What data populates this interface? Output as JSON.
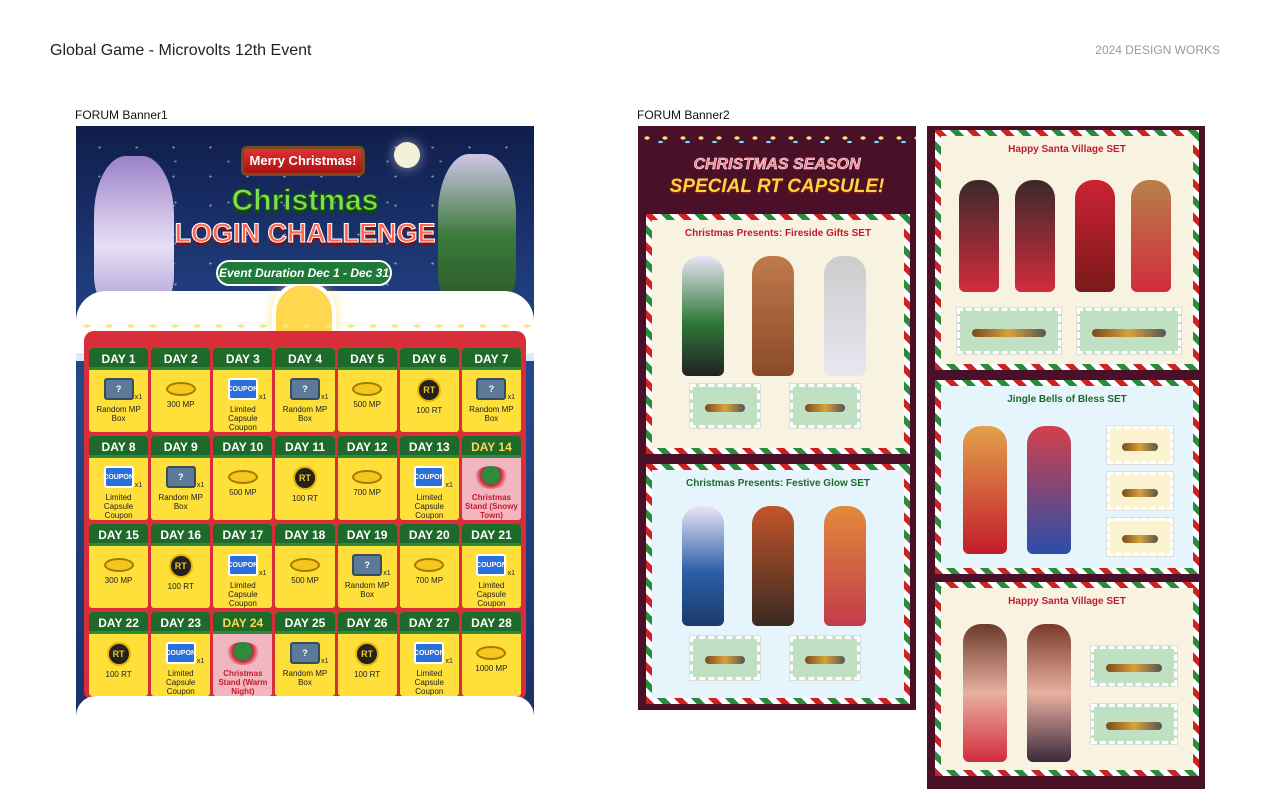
{
  "header": {
    "title": "Global Game - Microvolts 12th Event",
    "right_label": "2024 DESIGN WORKS"
  },
  "banner1": {
    "label": "FORUM Banner1",
    "sign": "Merry Christmas!",
    "title1": "Christmas",
    "title2": "LOGIN CHALLENGE",
    "duration": "Event Duration Dec 1 - Dec 31",
    "days": [
      {
        "day": "DAY 1",
        "type": "box",
        "qty": "x1",
        "name": "Random MP Box"
      },
      {
        "day": "DAY 2",
        "type": "mp",
        "qty": "",
        "name": "300 MP"
      },
      {
        "day": "DAY 3",
        "type": "cp",
        "qty": "x1",
        "name": "Limited Capsule Coupon"
      },
      {
        "day": "DAY 4",
        "type": "box",
        "qty": "x1",
        "name": "Random MP Box"
      },
      {
        "day": "DAY 5",
        "type": "mp",
        "qty": "",
        "name": "500 MP"
      },
      {
        "day": "DAY 6",
        "type": "rt",
        "qty": "",
        "name": "100 RT"
      },
      {
        "day": "DAY 7",
        "type": "box",
        "qty": "x1",
        "name": "Random MP Box"
      },
      {
        "day": "DAY 8",
        "type": "cp",
        "qty": "x1",
        "name": "Limited Capsule Coupon"
      },
      {
        "day": "DAY 9",
        "type": "box",
        "qty": "x1",
        "name": "Random MP Box"
      },
      {
        "day": "DAY 10",
        "type": "mp",
        "qty": "",
        "name": "500 MP"
      },
      {
        "day": "DAY 11",
        "type": "rt",
        "qty": "",
        "name": "100 RT"
      },
      {
        "day": "DAY 12",
        "type": "mp",
        "qty": "",
        "name": "700 MP"
      },
      {
        "day": "DAY 13",
        "type": "cp",
        "qty": "x1",
        "name": "Limited Capsule Coupon"
      },
      {
        "day": "DAY 14",
        "type": "tree",
        "qty": "",
        "name": "Christmas Stand (Snowy Town)",
        "special": true
      },
      {
        "day": "DAY 15",
        "type": "mp",
        "qty": "",
        "name": "300 MP"
      },
      {
        "day": "DAY 16",
        "type": "rt",
        "qty": "",
        "name": "100 RT"
      },
      {
        "day": "DAY 17",
        "type": "cp",
        "qty": "x1",
        "name": "Limited Capsule Coupon"
      },
      {
        "day": "DAY 18",
        "type": "mp",
        "qty": "",
        "name": "500 MP"
      },
      {
        "day": "DAY 19",
        "type": "box",
        "qty": "x1",
        "name": "Random MP Box"
      },
      {
        "day": "DAY 20",
        "type": "mp",
        "qty": "",
        "name": "700 MP"
      },
      {
        "day": "DAY 21",
        "type": "cp",
        "qty": "x1",
        "name": "Limited Capsule Coupon"
      },
      {
        "day": "DAY 22",
        "type": "rt",
        "qty": "",
        "name": "100 RT"
      },
      {
        "day": "DAY 23",
        "type": "cp",
        "qty": "x1",
        "name": "Limited Capsule Coupon"
      },
      {
        "day": "DAY 24",
        "type": "tree",
        "qty": "",
        "name": "Christmas Stand (Warm Night)",
        "special": true
      },
      {
        "day": "DAY 25",
        "type": "box",
        "qty": "x1",
        "name": "Random MP Box"
      },
      {
        "day": "DAY 26",
        "type": "rt",
        "qty": "",
        "name": "100 RT"
      },
      {
        "day": "DAY 27",
        "type": "cp",
        "qty": "x1",
        "name": "Limited Capsule Coupon"
      },
      {
        "day": "DAY 28",
        "type": "mp",
        "qty": "",
        "name": "1000 MP"
      }
    ]
  },
  "banner2": {
    "label": "FORUM Banner2",
    "title1": "CHRISTMAS SEASON",
    "title2": "SPECIAL RT CAPSULE!",
    "set_a": "Christmas Presents: Fireside Gifts SET",
    "set_b": "Christmas Presents: Festive Glow SET",
    "set_c": "Happy Santa Village SET",
    "set_d": "Jingle Bells of Bless SET",
    "set_e": "Happy Santa Village SET"
  },
  "icon_text": {
    "box": "?",
    "rt": "RT",
    "cp": "COUPON"
  },
  "colors": {
    "green": "#1e6a2a",
    "red": "#d92d3a",
    "gold": "#ffdf3a",
    "wine": "#4a1028"
  }
}
